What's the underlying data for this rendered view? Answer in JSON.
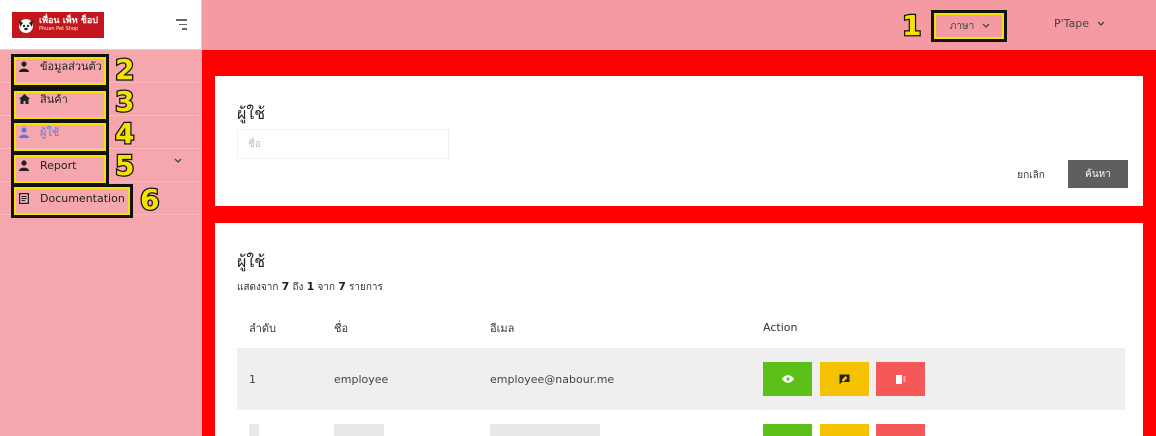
{
  "sidebar": {
    "logo": {
      "main": "เพื่อน เพ็ท ช็อป",
      "sub": "Phuan Pet Shop"
    },
    "items": [
      {
        "label": "ข้อมูลส่วนตัว",
        "icon": "person-icon",
        "active": false
      },
      {
        "label": "สินค้า",
        "icon": "home-icon",
        "active": false
      },
      {
        "label": "ผู้ใช้",
        "icon": "person-icon",
        "active": true
      },
      {
        "label": "Report",
        "icon": "person-icon",
        "active": false,
        "has_submenu": true
      },
      {
        "label": "Documentation",
        "icon": "document-icon",
        "active": false
      }
    ]
  },
  "header": {
    "language_label": "ภาษา",
    "user_name": "P'Tape"
  },
  "annotations": [
    "1",
    "2",
    "3",
    "4",
    "5",
    "6"
  ],
  "search_card": {
    "title": "ผู้ใช้",
    "name_placeholder": "ชื่อ",
    "cancel_label": "ยกเลิก",
    "search_label": "ค้นหา"
  },
  "list_card": {
    "title": "ผู้ใช้",
    "summary": {
      "prefix": "แสดงจาก",
      "from": "7",
      "to_word": "ถึง",
      "to": "1",
      "of_word": "จาก",
      "total": "7",
      "suffix": "รายการ"
    },
    "columns": [
      "ลำดับ",
      "ชื่อ",
      "อีเมล",
      "Action"
    ],
    "rows": [
      {
        "no": "1",
        "name": "employee",
        "email": "employee@nabour.me"
      }
    ]
  },
  "colors": {
    "sidebar_bg": "#f6a7ae",
    "header_bg": "#f49aa3",
    "content_bg": "#ff0000",
    "view_button": "#5dc018",
    "edit_button": "#f5c200",
    "delete_button": "#f45858",
    "search_button": "#5f5f5f",
    "active_menu_text": "#5b7ce6",
    "annotation_fill": "#f6e200"
  }
}
